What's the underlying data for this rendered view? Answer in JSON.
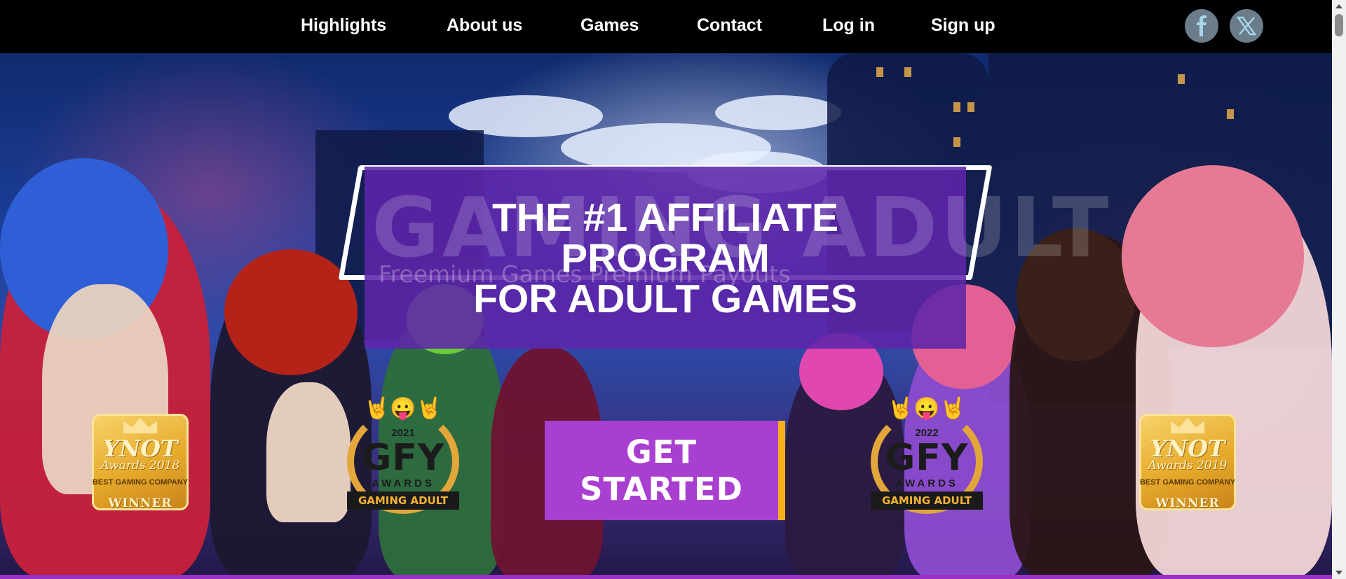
{
  "nav": {
    "items": [
      {
        "label": "Highlights"
      },
      {
        "label": "About us"
      },
      {
        "label": "Games"
      },
      {
        "label": "Contact"
      },
      {
        "label": "Log in"
      },
      {
        "label": "Sign up"
      }
    ],
    "social": [
      {
        "icon": "facebook-icon",
        "glyph": "f"
      },
      {
        "icon": "x-twitter-icon",
        "glyph": "X"
      }
    ]
  },
  "hero": {
    "logo_text": "GAMING ADULT",
    "logo_tagline": "Freemium Games Premium Payouts",
    "headline_lines": [
      "THE #1 AFFILIATE",
      "PROGRAM",
      "FOR ADULT GAMES"
    ],
    "cta_label": "GET STARTED",
    "badges": {
      "ynot_left": {
        "brand": "YNOT",
        "award": "Awards 2018",
        "category": "BEST GAMING COMPANY",
        "result": "WINNER"
      },
      "ynot_right": {
        "brand": "YNOT",
        "award": "Awards 2019",
        "category": "BEST GAMING COMPANY",
        "result": "WINNER"
      },
      "gfy_left": {
        "year": "2021",
        "name": "GFY",
        "subtitle": "AWARDS",
        "ribbon": "GAMING ADULT"
      },
      "gfy_right": {
        "year": "2022",
        "name": "GFY",
        "subtitle": "AWARDS",
        "ribbon": "GAMING ADULT"
      }
    }
  },
  "colors": {
    "nav_background": "#000000",
    "headline_box": "#5f24aa",
    "cta_background": "#a93fd0",
    "cta_accent": "#f3b21a",
    "social_circle": "#6b7c8a",
    "bottom_strip": "#9a2fc4"
  }
}
